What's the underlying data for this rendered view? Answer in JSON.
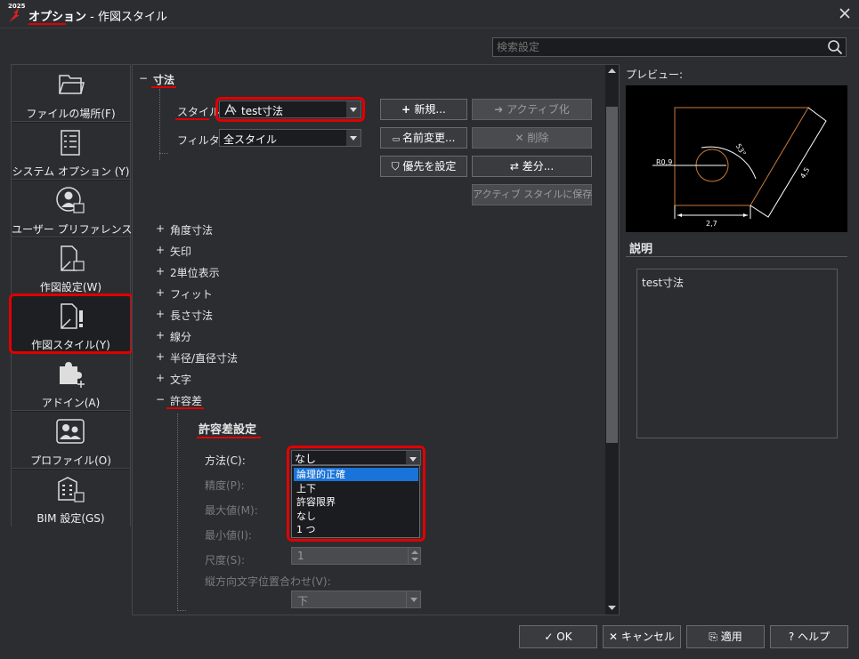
{
  "window": {
    "logo_year": "2025",
    "title_bold": "オプション",
    "title_rest": " - 作図スタイル"
  },
  "search": {
    "placeholder": "検索設定"
  },
  "sidebar": {
    "items": [
      {
        "label": "ファイルの場所(F)",
        "icon": "folder-icon"
      },
      {
        "label": "システム オプション (Y)",
        "icon": "checklist-icon"
      },
      {
        "label": "ユーザー プリファレンス(U)",
        "icon": "user-prefs-icon"
      },
      {
        "label": "作図設定(W)",
        "icon": "drawing-settings-icon"
      },
      {
        "label": "作図スタイル(Y)",
        "icon": "drawing-style-icon"
      },
      {
        "label": "アドイン(A)",
        "icon": "puzzle-icon"
      },
      {
        "label": "プロファイル(O)",
        "icon": "profile-icon"
      },
      {
        "label": "BIM 設定(GS)",
        "icon": "building-icon"
      }
    ],
    "active_index": 4
  },
  "dimension": {
    "section_label": "寸法",
    "style_label": "スタイル:",
    "style_value": "test寸法",
    "filter_label": "フィルタ:",
    "filter_value": "全スタイル",
    "buttons": {
      "new": "新規...",
      "activate": "アクティブ化",
      "rename": "名前変更...",
      "delete": "削除",
      "priority": "優先を設定",
      "diff": "差分...",
      "save_active": "アクティブ スタイルに保存"
    },
    "subsections": [
      "角度寸法",
      "矢印",
      "2単位表示",
      "フィット",
      "長さ寸法",
      "線分",
      "半径/直径寸法",
      "文字"
    ],
    "tolerance_label": "許容差"
  },
  "tolerance": {
    "group_title": "許容差設定",
    "method_label": "方法(C):",
    "method_value": "なし",
    "method_options": [
      "論理的正確",
      "上下",
      "許容限界",
      "なし",
      "1 つ"
    ],
    "highlighted_option": "論理的正確",
    "precision_label": "精度(P):",
    "max_label": "最大値(M):",
    "min_label": "最小値(I):",
    "scale_label": "尺度(S):",
    "scale_value": "1",
    "vertical_label": "縦方向文字位置合わせ(V):",
    "vertical_value": "下"
  },
  "preview": {
    "label": "プレビュー:",
    "dim_radius": "R0,9",
    "dim_angle": "53°",
    "dim_length": "2,7",
    "dim_diag": "4,5"
  },
  "description": {
    "label": "説明",
    "text": "test寸法"
  },
  "footer": {
    "ok": "OK",
    "cancel": "キャンセル",
    "apply": "適用",
    "help": "ヘルプ"
  },
  "colors": {
    "highlight_red": "#e00000",
    "selection_blue": "#1a73d9",
    "preview_line": "#c87a3a"
  }
}
